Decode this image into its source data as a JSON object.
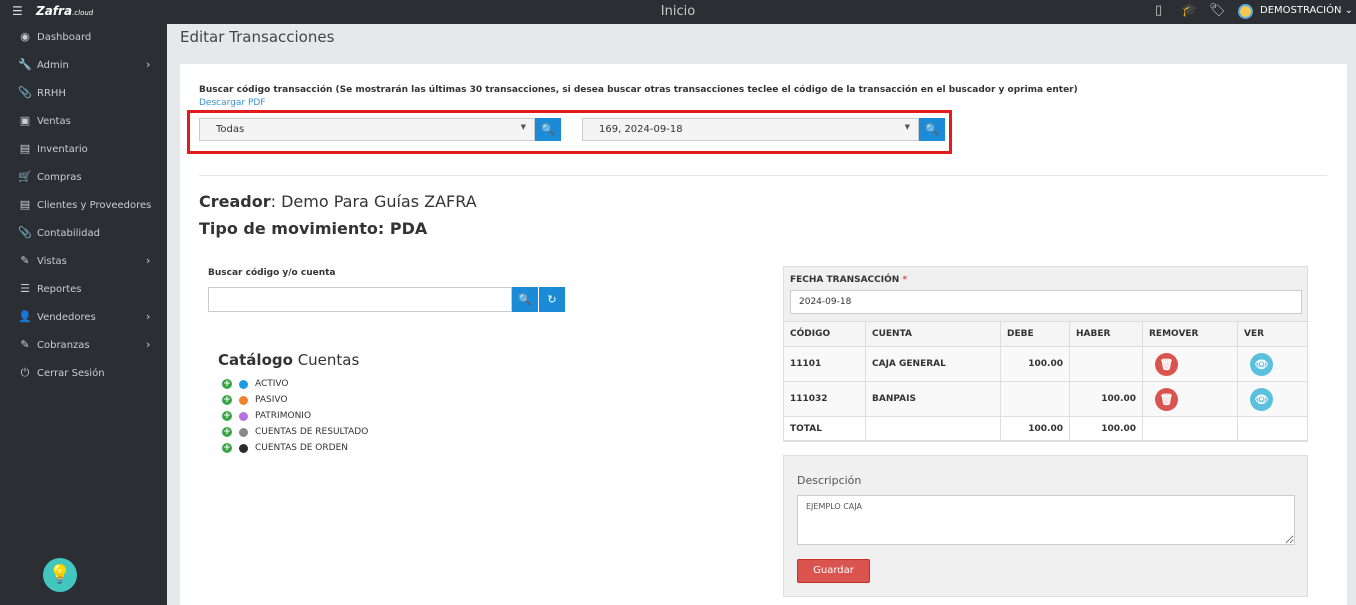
{
  "topbar": {
    "brand": "Zafra",
    "brand_suffix": ".cloud",
    "title": "Inicio",
    "user": "DEMOSTRACIÓN"
  },
  "sidebar": {
    "items": [
      {
        "label": "Dashboard",
        "icon": "dashboard-icon"
      },
      {
        "label": "Admin",
        "icon": "wrench-icon",
        "has_submenu": true
      },
      {
        "label": "RRHH",
        "icon": "paperclip-icon"
      },
      {
        "label": "Ventas",
        "icon": "money-icon"
      },
      {
        "label": "Inventario",
        "icon": "book-icon"
      },
      {
        "label": "Compras",
        "icon": "cart-icon"
      },
      {
        "label": "Clientes y Proveedores",
        "icon": "book-icon"
      },
      {
        "label": "Contabilidad",
        "icon": "paperclip-icon"
      },
      {
        "label": "Vistas",
        "icon": "edit-icon",
        "has_submenu": true
      },
      {
        "label": "Reportes",
        "icon": "list-icon"
      },
      {
        "label": "Vendedores",
        "icon": "user-icon",
        "has_submenu": true
      },
      {
        "label": "Cobranzas",
        "icon": "edit-icon",
        "has_submenu": true
      },
      {
        "label": "Cerrar Sesión",
        "icon": "power-icon"
      }
    ]
  },
  "page": {
    "title": "Editar Transacciones",
    "search_hint": "Buscar código transacción (Se mostrarán las últimas 30 transacciones, si desea buscar otras transacciones teclee el código de la transacción en el buscador y oprima enter)",
    "pdf_link": "Descargar PDF",
    "filter_select": "Todas",
    "transaction_select": "169, 2024-09-18",
    "creator_label": "Creador",
    "creator_value": "Demo Para Guías ZAFRA",
    "movement_label": "Tipo de movimiento:",
    "movement_value": "PDA",
    "account_search_label": "Buscar código y/o cuenta",
    "account_search_value": "",
    "catalog_title_bold": "Catálogo",
    "catalog_title_rest": "Cuentas",
    "catalog": [
      {
        "label": "ACTIVO",
        "color": "#1e9be0"
      },
      {
        "label": "PASIVO",
        "color": "#f0842a"
      },
      {
        "label": "PATRIMONIO",
        "color": "#b772e0"
      },
      {
        "label": "CUENTAS DE RESULTADO",
        "color": "#8a8a8a"
      },
      {
        "label": "CUENTAS DE ORDEN",
        "color": "#2a2a2a"
      }
    ]
  },
  "transaction": {
    "date_label": "FECHA TRANSACCIÓN",
    "date_required_mark": "*",
    "date_value": "2024-09-18",
    "headers": [
      "CÓDIGO",
      "CUENTA",
      "DEBE",
      "HABER",
      "REMOVER",
      "VER"
    ],
    "rows": [
      {
        "code": "11101",
        "account": "CAJA GENERAL",
        "debit": "100.00",
        "credit": ""
      },
      {
        "code": "111032",
        "account": "BANPAIS",
        "debit": "",
        "credit": "100.00"
      }
    ],
    "total_label": "TOTAL",
    "total_debit": "100.00",
    "total_credit": "100.00"
  },
  "description": {
    "label": "Descripción",
    "value": "EJEMPLO CAJA",
    "save_label": "Guardar"
  },
  "colors": {
    "primary": "#1c8bd7",
    "danger": "#d9534f",
    "info": "#5bc0de",
    "sidebar": "#2b2f33",
    "highlight": "#e21c1c"
  }
}
